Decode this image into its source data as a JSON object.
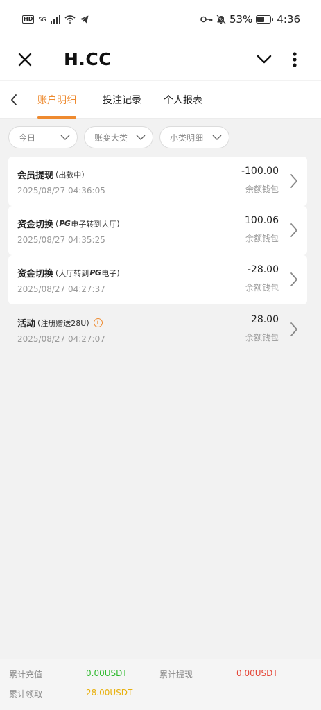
{
  "status_bar": {
    "hd": "HD",
    "signal_label": "5G",
    "battery": "53%",
    "time": "4:36"
  },
  "header": {
    "title": "H.CC"
  },
  "tabs": [
    {
      "label": "账户明细",
      "active": true
    },
    {
      "label": "投注记录",
      "active": false
    },
    {
      "label": "个人报表",
      "active": false
    }
  ],
  "filters": [
    {
      "label": "今日"
    },
    {
      "label": "账变大类"
    },
    {
      "label": "小类明细"
    }
  ],
  "records": [
    {
      "title": "会员提现",
      "sub_open": "(",
      "sub_text": "出款中",
      "sub_close": ")",
      "time": "2025/08/27 04:36:05",
      "amount": "-100.00",
      "wallet": "余额钱包"
    },
    {
      "title": "资金切换",
      "sub_open": "(",
      "sub_pre": "",
      "sub_brand": "PG",
      "sub_post": "电子转到大厅",
      "sub_close": ")",
      "time": "2025/08/27 04:35:25",
      "amount": "100.06",
      "wallet": "余额钱包"
    },
    {
      "title": "资金切换",
      "sub_open": "(",
      "sub_pre": "大厅转到",
      "sub_brand": "PG",
      "sub_post": "电子",
      "sub_close": ")",
      "time": "2025/08/27 04:27:37",
      "amount": "-28.00",
      "wallet": "余额钱包"
    },
    {
      "title": "活动",
      "sub_open": "(",
      "sub_text": "注册赠送28U",
      "sub_close": ")",
      "time": "2025/08/27 04:27:07",
      "amount": "28.00",
      "wallet": "余额钱包"
    }
  ],
  "summary": {
    "deposit_label": "累计充值",
    "deposit_value": "0.00USDT",
    "withdraw_label": "累计提现",
    "withdraw_value": "0.00USDT",
    "claimed_label": "累计领取",
    "claimed_value": "28.00USDT"
  },
  "colors": {
    "accent": "#ee8a2f",
    "deposit": "#2db92d",
    "withdraw": "#e5483a",
    "claimed": "#e8b10f"
  },
  "icons": [
    "close-icon",
    "chevron-down-icon",
    "more-vertical-icon",
    "back-chevron-icon",
    "chevron-right-icon",
    "info-icon",
    "wifi-icon",
    "signal-icon",
    "key-icon",
    "mute-bell-icon",
    "battery-icon",
    "telegram-icon"
  ]
}
